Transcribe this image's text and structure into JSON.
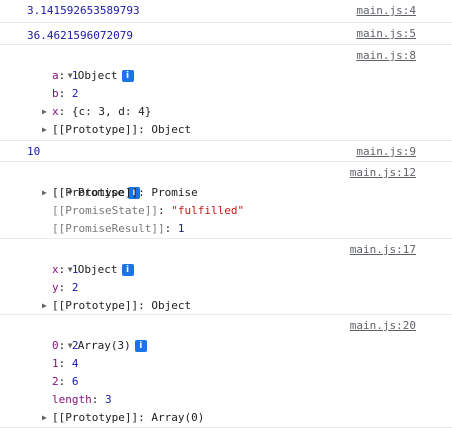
{
  "logs": [
    {
      "text": "3.141592653589793",
      "source": "main.js:4"
    },
    {
      "text": "36.4621596072079",
      "source": "main.js:5"
    },
    {
      "label": "Object",
      "source": "main.js:8",
      "props": [
        {
          "key": "a",
          "value": "1"
        },
        {
          "key": "b",
          "value": "2"
        },
        {
          "key": "x",
          "value": "{c: 3, d: 4}"
        }
      ],
      "prototype": "[[Prototype]]: Object"
    },
    {
      "text": "10",
      "source": "main.js:9"
    },
    {
      "label": "Promise",
      "source": "main.js:12",
      "prototype": "[[Prototype]]: Promise",
      "state_key": "[[PromiseState]]",
      "state_value": "\"fulfilled\"",
      "result_key": "[[PromiseResult]]",
      "result_value": "1"
    },
    {
      "label": "Object",
      "source": "main.js:17",
      "props": [
        {
          "key": "x",
          "value": "1"
        },
        {
          "key": "y",
          "value": "2"
        }
      ],
      "prototype": "[[Prototype]]: Object"
    },
    {
      "label": "Array(3)",
      "source": "main.js:20",
      "props": [
        {
          "key": "0",
          "value": "2"
        },
        {
          "key": "1",
          "value": "4"
        },
        {
          "key": "2",
          "value": "6"
        },
        {
          "key": "length",
          "value": "3"
        }
      ],
      "prototype": "[[Prototype]]: Array(0)"
    }
  ],
  "icons": {
    "expanded": "▼",
    "collapsed": "▶",
    "info": "i"
  },
  "colors": {
    "number": "#1a1aa6",
    "key": "#881280",
    "string": "#c41a16",
    "info_badge": "#1a73e8"
  }
}
